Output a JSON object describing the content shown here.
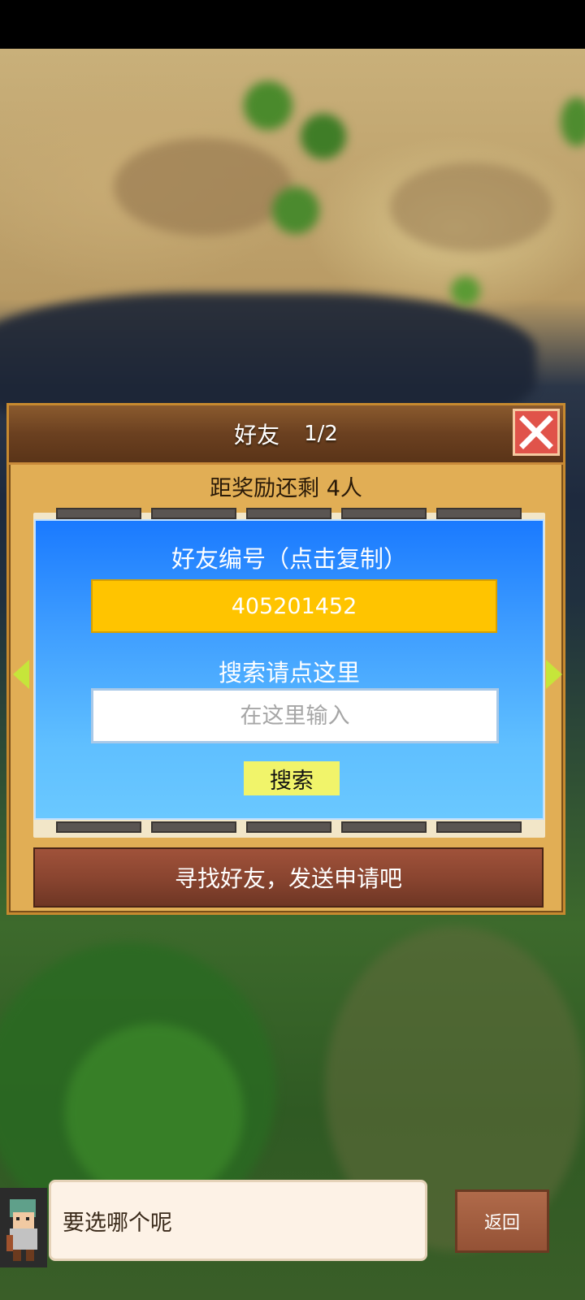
{
  "dialog": {
    "title": "好友",
    "page_indicator": "1/2",
    "reward_text": "距奖励还剩 4人",
    "close_icon": "close-x-icon",
    "accent_color": "#e1ae55"
  },
  "friend_panel": {
    "id_label": "好友编号（点击复制）",
    "friend_id": "405201452",
    "search_label": "搜索请点这里",
    "search_placeholder": "在这里输入",
    "search_value": "",
    "search_button_label": "搜索"
  },
  "navigation": {
    "prev_icon": "arrow-left-icon",
    "next_icon": "arrow-right-icon"
  },
  "find_friends_bar": {
    "label": "寻找好友，发送申请吧"
  },
  "footer": {
    "message": "要选哪个呢",
    "back_label": "返回"
  }
}
